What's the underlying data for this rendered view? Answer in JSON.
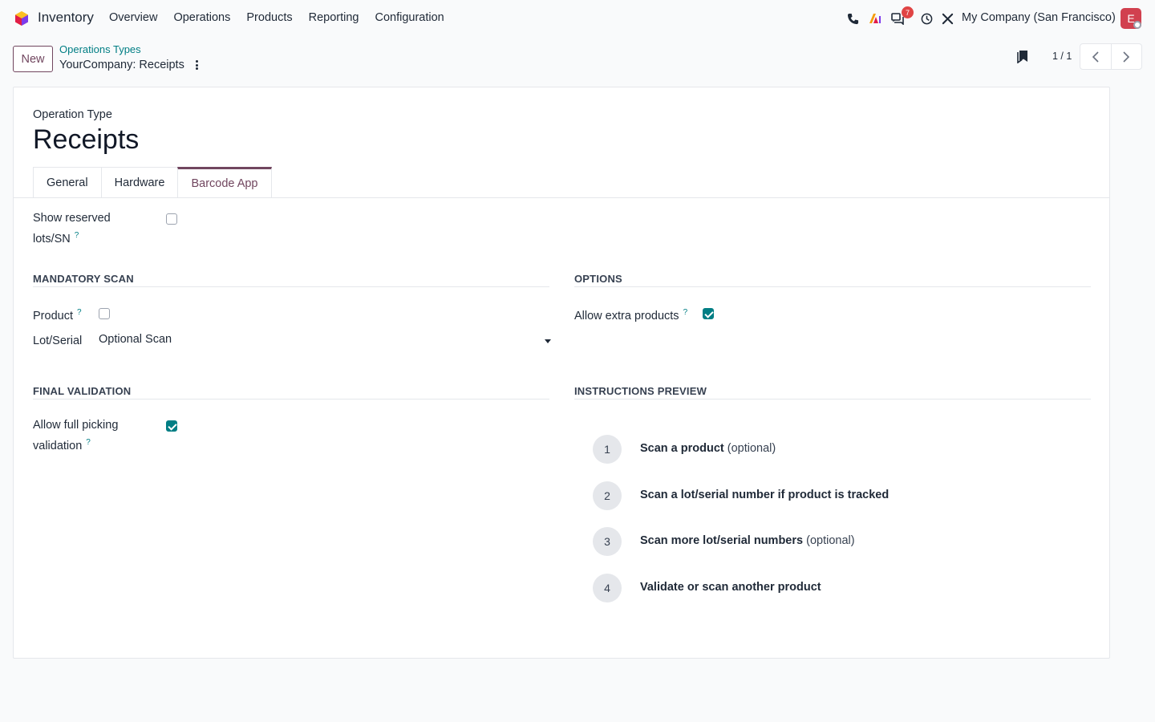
{
  "navbar": {
    "app_name": "Inventory",
    "menu": [
      "Overview",
      "Operations",
      "Products",
      "Reporting",
      "Configuration"
    ],
    "messages_badge": "7",
    "company": "My Company (San Francisco)",
    "avatar_letter": "E"
  },
  "control_panel": {
    "new_label": "New",
    "breadcrumb_parent": "Operations Types",
    "breadcrumb_current": "YourCompany: Receipts",
    "pager": "1 / 1"
  },
  "form": {
    "type_label": "Operation Type",
    "title": "Receipts",
    "tabs": [
      "General",
      "Hardware",
      "Barcode App"
    ],
    "active_tab": "Barcode App",
    "show_reserved_label_1": "Show reserved",
    "show_reserved_label_2": "lots/SN",
    "show_reserved_checked": false,
    "mandatory_scan": {
      "heading": "MANDATORY SCAN",
      "product_label": "Product",
      "product_checked": false,
      "lot_label": "Lot/Serial",
      "lot_value": "Optional Scan"
    },
    "options": {
      "heading": "OPTIONS",
      "allow_extra_label": "Allow extra products",
      "allow_extra_checked": true
    },
    "final_validation": {
      "heading": "FINAL VALIDATION",
      "allow_full_label_1": "Allow full picking",
      "allow_full_label_2": "validation",
      "allow_full_checked": true
    },
    "instructions": {
      "heading": "INSTRUCTIONS PREVIEW",
      "steps": [
        {
          "num": "1",
          "bold": "Scan a product",
          "suffix": "(optional)"
        },
        {
          "num": "2",
          "bold": "Scan a lot/serial number if product is tracked",
          "suffix": ""
        },
        {
          "num": "3",
          "bold": "Scan more lot/serial numbers",
          "suffix": "(optional)"
        },
        {
          "num": "4",
          "bold": "Validate or scan another product",
          "suffix": ""
        }
      ]
    },
    "help_mark": "?"
  },
  "colors": {
    "brand": "#71465f",
    "accent": "#017e84",
    "badge": "#e04444"
  }
}
